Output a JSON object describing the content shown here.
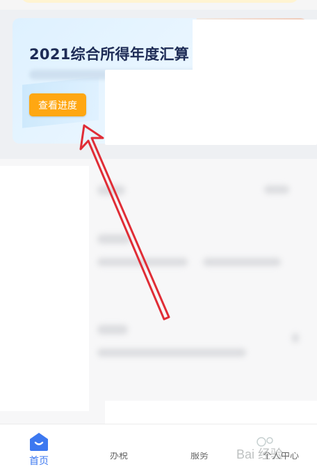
{
  "card": {
    "title": "2021综合所得年度汇算",
    "button_label": "查看进度"
  },
  "bottom_nav": {
    "items": [
      {
        "label": "首页",
        "active": true,
        "icon": "home-icon"
      },
      {
        "label": "办税",
        "active": false
      },
      {
        "label": "服务",
        "active": false
      },
      {
        "label": "个人中心",
        "active": false
      }
    ]
  },
  "watermark": {
    "text": "Bai 经验"
  },
  "colors": {
    "accent_orange": "#ffa712",
    "nav_active": "#3c78f0",
    "title_text": "#1d2b55",
    "annotation_arrow": "#e02d36"
  }
}
